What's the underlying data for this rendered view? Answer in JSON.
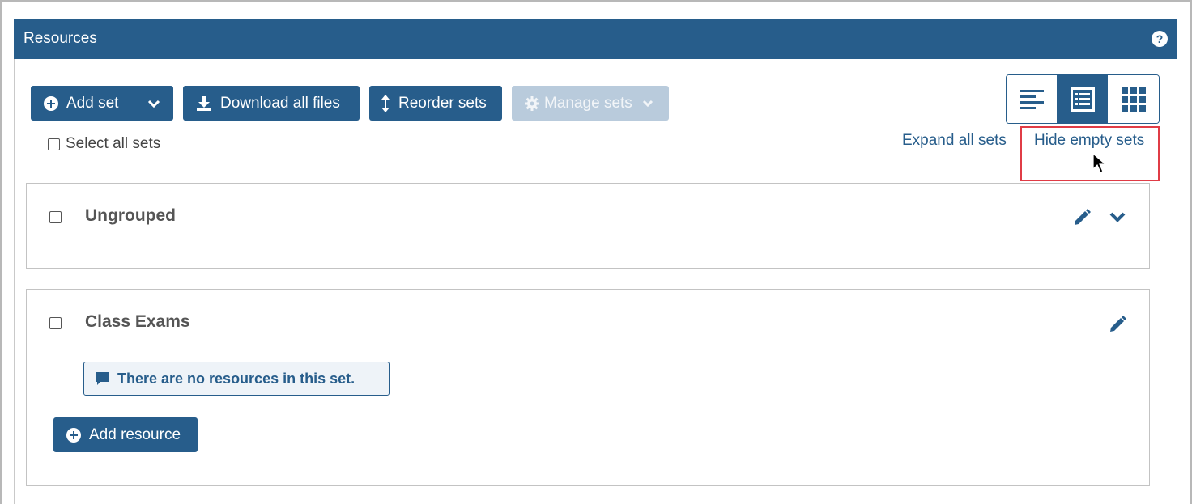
{
  "header": {
    "title": "Resources",
    "help_icon": "?"
  },
  "toolbar": {
    "add_set_label": "Add set",
    "download_label": "Download all files",
    "reorder_label": "Reorder sets",
    "manage_label": "Manage sets"
  },
  "view_toggle": {
    "options": [
      "list-view-icon",
      "detail-view-icon",
      "grid-view-icon"
    ],
    "active": "detail-view-icon"
  },
  "select_all_label": "Select all sets",
  "links": {
    "expand_all": "Expand all sets",
    "hide_empty": "Hide empty sets"
  },
  "sets": [
    {
      "title": "Ungrouped"
    },
    {
      "title": "Class Exams",
      "empty_notice": "There are no resources in this set.",
      "add_resource_label": "Add resource"
    }
  ],
  "colors": {
    "primary": "#275d8b",
    "disabled": "#b9cbdc",
    "highlight": "#e03c46"
  }
}
